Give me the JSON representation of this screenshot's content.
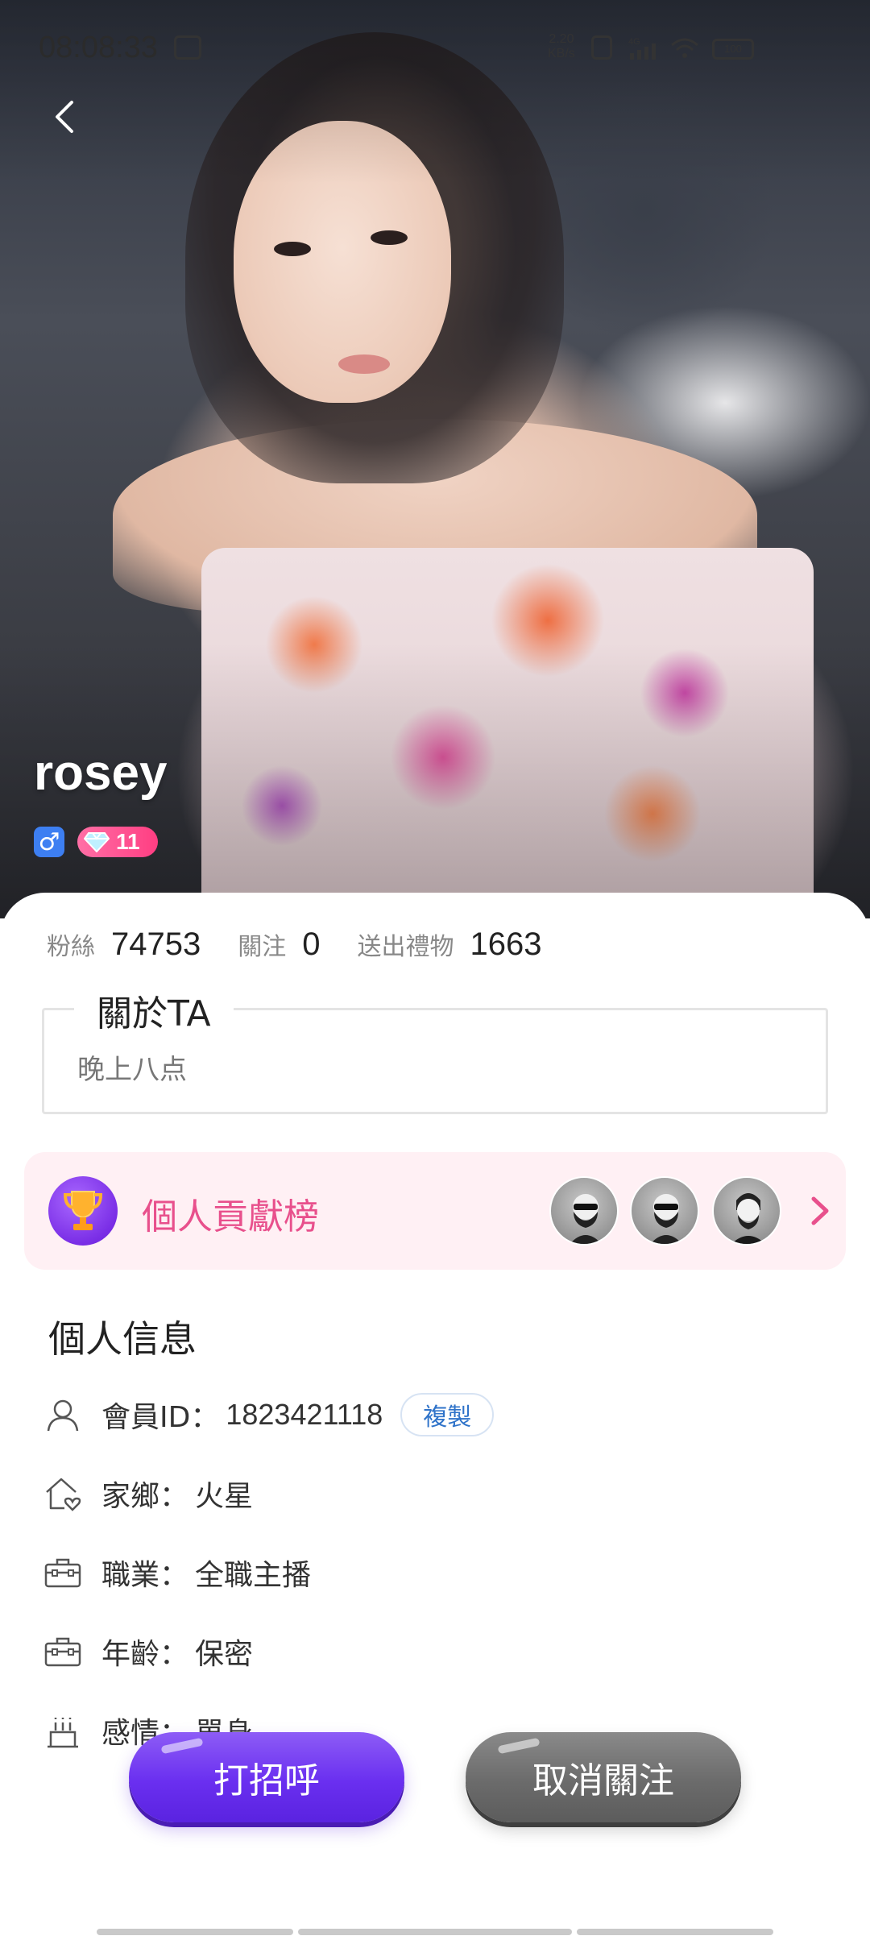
{
  "status_bar": {
    "time": "08:08:33",
    "network_speed": "2.20",
    "network_unit": "KB/s",
    "cellular": "4G",
    "battery": "100"
  },
  "profile": {
    "name": "rosey",
    "gender_symbol": "♂",
    "level": "11"
  },
  "stats": [
    {
      "label": "粉絲",
      "value": "74753"
    },
    {
      "label": "關注",
      "value": "0"
    },
    {
      "label": "送出禮物",
      "value": "1663"
    }
  ],
  "about": {
    "title": "關於TA",
    "text": "晚上八点"
  },
  "contribution": {
    "label": "個人貢獻榜",
    "avatar_count": 3
  },
  "personal_info": {
    "title": "個人信息",
    "separator": "：",
    "member_id_label": "會員ID",
    "member_id": "1823421118",
    "copy_label": "複製",
    "hometown_label": "家鄉",
    "hometown": "火星",
    "job_label": "職業",
    "job": "全職主播",
    "age_label": "年齡",
    "age": "保密",
    "relationship_label": "感情",
    "relationship": "單身"
  },
  "actions": {
    "greet": "打招呼",
    "unfollow": "取消關注"
  },
  "colors": {
    "accent_pink": "#e8508c",
    "greet_purple": "#6a2ff0",
    "unfollow_gray": "#6b6b6b",
    "copy_blue": "#2f73c9"
  },
  "icons": {
    "back": "chevron-left-icon",
    "gender": "male-icon",
    "level": "diamond-icon",
    "trophy": "trophy-icon",
    "member": "user-icon",
    "hometown": "home-heart-icon",
    "job": "briefcase-icon",
    "age": "briefcase-icon",
    "relationship": "cake-icon"
  }
}
